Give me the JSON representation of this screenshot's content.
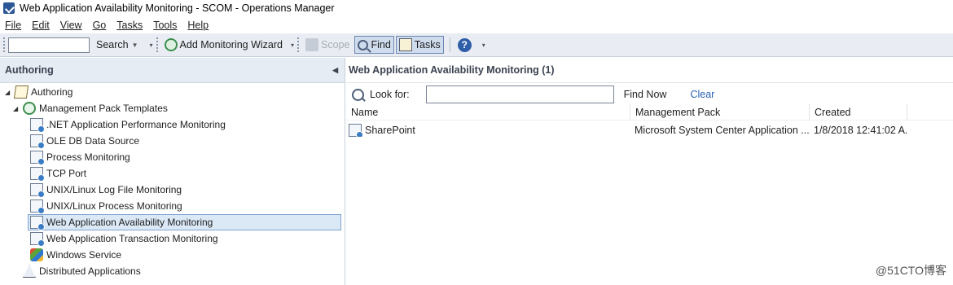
{
  "window": {
    "title": "Web Application Availability Monitoring - SCOM - Operations Manager"
  },
  "menu": [
    "File",
    "Edit",
    "View",
    "Go",
    "Tasks",
    "Tools",
    "Help"
  ],
  "toolbar": {
    "search_label": "Search",
    "add_wizard_label": "Add Monitoring Wizard",
    "scope_label": "Scope",
    "find_label": "Find",
    "tasks_label": "Tasks",
    "help_icon": "?"
  },
  "left_pane": {
    "header": "Authoring",
    "tree": [
      {
        "label": "Authoring",
        "icon": "authoring-icon"
      },
      {
        "label": "Management Pack Templates",
        "icon": "management-pack-templates-icon"
      },
      {
        "label": ".NET Application Performance Monitoring",
        "icon": "template-icon"
      },
      {
        "label": "OLE DB Data Source",
        "icon": "template-icon"
      },
      {
        "label": "Process Monitoring",
        "icon": "template-icon"
      },
      {
        "label": "TCP Port",
        "icon": "template-icon"
      },
      {
        "label": "UNIX/Linux Log File Monitoring",
        "icon": "template-icon"
      },
      {
        "label": "UNIX/Linux Process Monitoring",
        "icon": "template-icon"
      },
      {
        "label": "Web Application Availability Monitoring",
        "icon": "template-icon",
        "selected": true
      },
      {
        "label": "Web Application Transaction Monitoring",
        "icon": "template-icon"
      },
      {
        "label": "Windows Service",
        "icon": "windows-service-icon"
      },
      {
        "label": "Distributed Applications",
        "icon": "distributed-applications-icon"
      }
    ]
  },
  "right_pane": {
    "header": "Web Application Availability Monitoring (1)",
    "look_for_label": "Look for:",
    "look_for_value": "",
    "find_now_label": "Find Now",
    "clear_label": "Clear",
    "columns": [
      "Name",
      "Management Pack",
      "Created"
    ],
    "rows": [
      {
        "name": "SharePoint",
        "management_pack": "Microsoft System Center Application ...",
        "created": "1/8/2018 12:41:02 A..."
      }
    ]
  },
  "watermark": "@51CTO博客"
}
